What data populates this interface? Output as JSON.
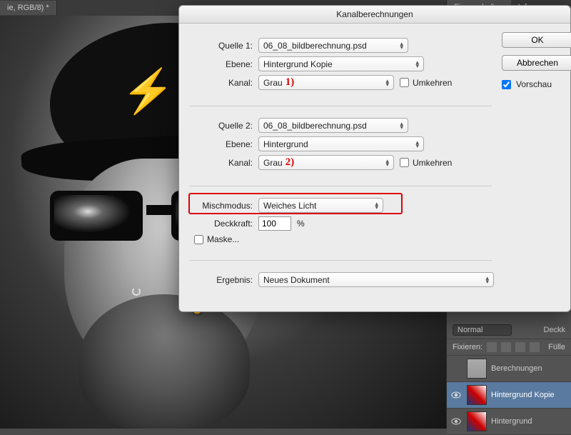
{
  "app": {
    "tab_title": "ie, RGB/8) *"
  },
  "right_panel": {
    "tabs": [
      "Eigenschaften",
      "Info"
    ],
    "blend_mode": "Normal",
    "opacity_label": "Deckk",
    "lock_label": "Fixieren:",
    "fill_label": "Fülle",
    "layers": [
      {
        "name": "Berechnungen",
        "visible": false,
        "selected": false,
        "thumb": "gray"
      },
      {
        "name": "Hintergrund Kopie",
        "visible": true,
        "selected": true,
        "thumb": "color"
      },
      {
        "name": "Hintergrund",
        "visible": true,
        "selected": false,
        "thumb": "color"
      }
    ]
  },
  "dialog": {
    "title": "Kanalberechnungen",
    "source1": {
      "label": "Quelle 1:",
      "file": "06_08_bildberechnung.psd",
      "layer_label": "Ebene:",
      "layer": "Hintergrund Kopie",
      "channel_label": "Kanal:",
      "channel": "Grau",
      "annotation": "1)",
      "invert_label": "Umkehren"
    },
    "source2": {
      "label": "Quelle 2:",
      "file": "06_08_bildberechnung.psd",
      "layer_label": "Ebene:",
      "layer": "Hintergrund",
      "channel_label": "Kanal:",
      "channel": "Grau",
      "annotation": "2)",
      "invert_label": "Umkehren"
    },
    "blend": {
      "label": "Mischmodus:",
      "value": "Weiches Licht"
    },
    "opacity": {
      "label": "Deckkraft:",
      "value": "100",
      "suffix": "%"
    },
    "mask_label": "Maske...",
    "result": {
      "label": "Ergebnis:",
      "value": "Neues Dokument"
    },
    "buttons": {
      "ok": "OK",
      "cancel": "Abbrechen"
    },
    "preview_label": "Vorschau"
  }
}
